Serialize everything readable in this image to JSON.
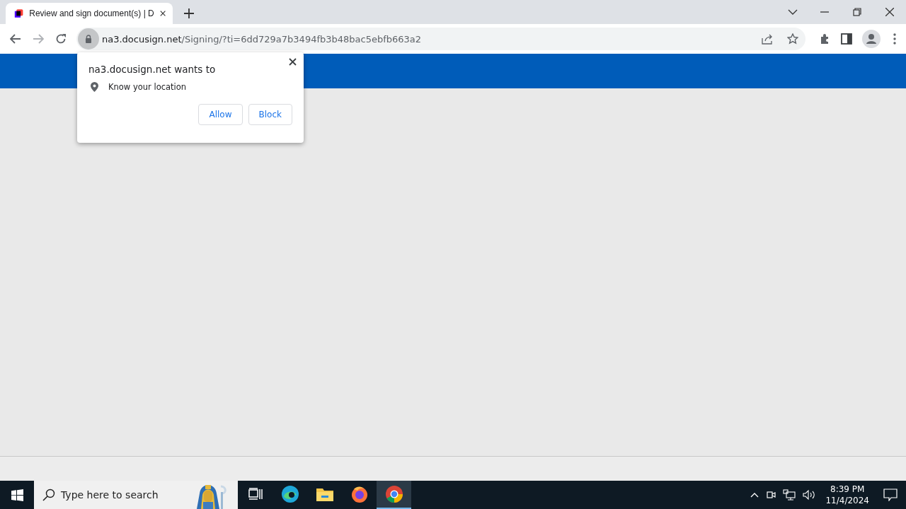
{
  "browser": {
    "tab": {
      "title": "Review and sign document(s) | D",
      "selected": true
    },
    "address": {
      "host": "na3.docusign.net",
      "path": "/Signing/?ti=6dd729a7b3494fb3b48bac5ebfb663a2"
    }
  },
  "permission_popup": {
    "title": "na3.docusign.net wants to",
    "request": "Know your location",
    "buttons": [
      "Allow",
      "Block"
    ]
  },
  "taskbar": {
    "search": {
      "placeholder": "Type here to search"
    },
    "apps": [
      {
        "kind": "taskview",
        "selected": false
      },
      {
        "kind": "edge",
        "selected": false
      },
      {
        "kind": "explorer",
        "selected": false
      },
      {
        "kind": "firefox",
        "selected": false
      },
      {
        "kind": "chrome",
        "selected": true
      }
    ],
    "clock": {
      "time": "8:39 PM",
      "date": "11/4/2024"
    }
  }
}
